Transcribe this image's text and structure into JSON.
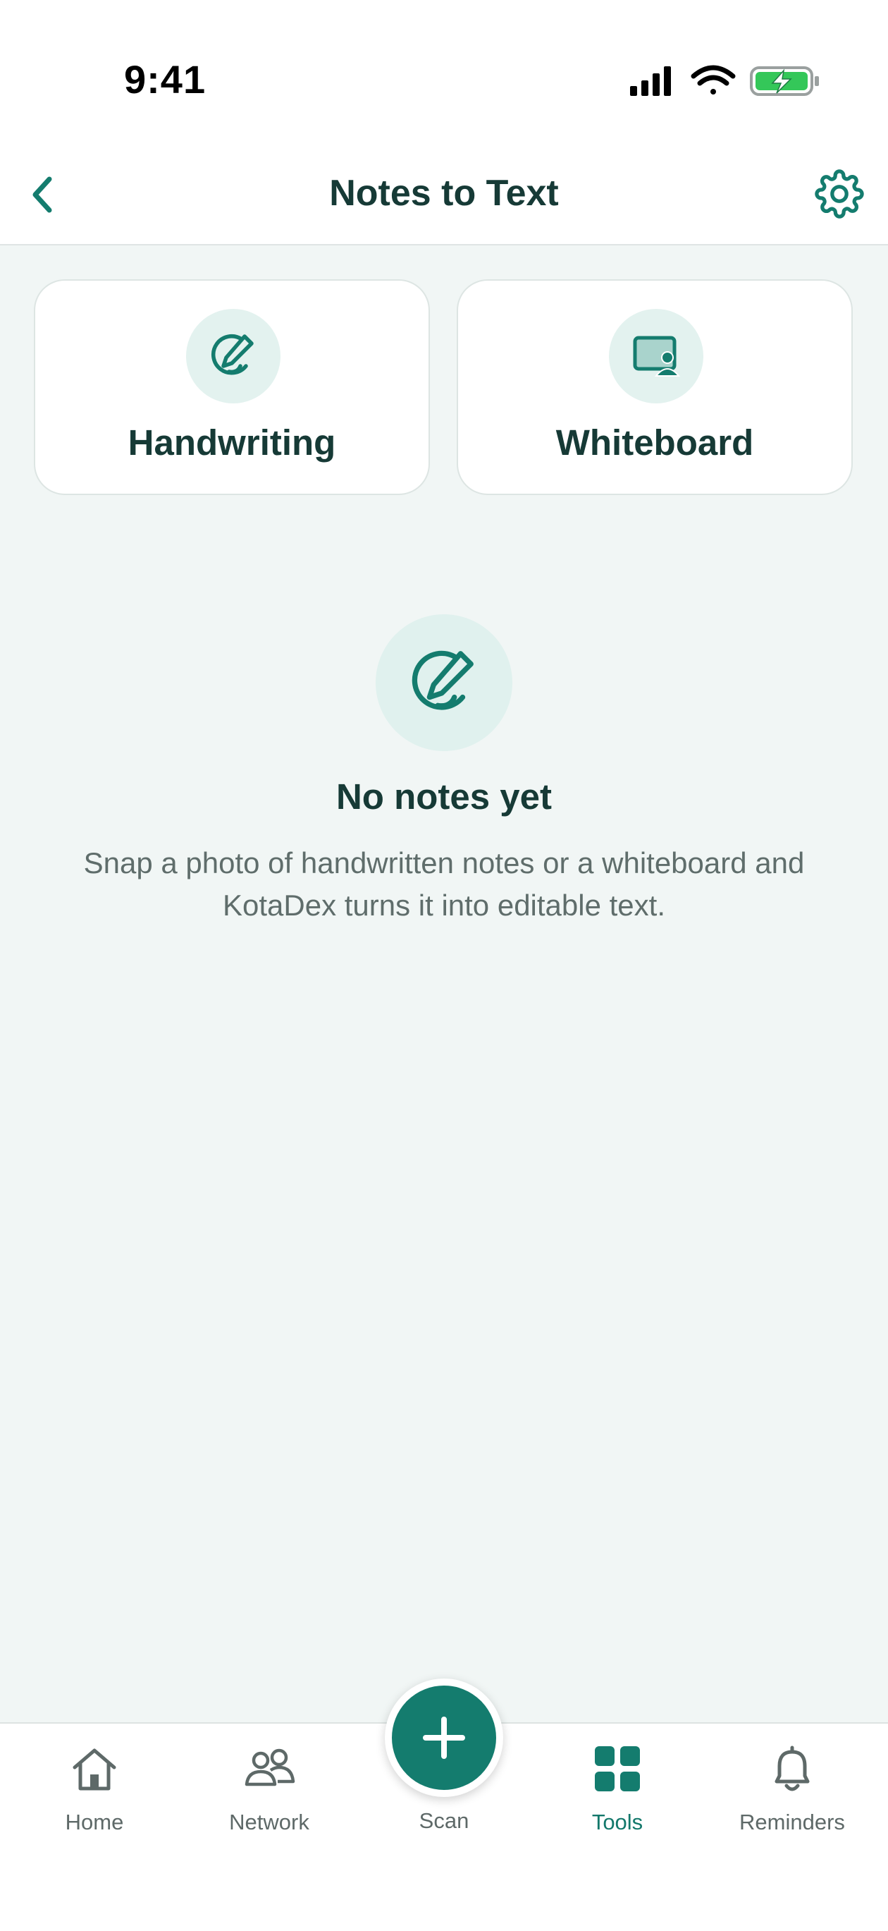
{
  "status_bar": {
    "time": "9:41"
  },
  "header": {
    "title": "Notes to Text",
    "back_icon": "chevron-left-icon",
    "settings_icon": "gear-icon"
  },
  "modes": [
    {
      "label": "Handwriting",
      "icon": "pen-circle-icon"
    },
    {
      "label": "Whiteboard",
      "icon": "whiteboard-presenter-icon"
    }
  ],
  "empty_state": {
    "icon": "pen-circle-icon",
    "title": "No notes yet",
    "description": "Snap a photo of handwritten notes or a whiteboard and KotaDex turns it into editable text."
  },
  "tab_bar": {
    "items": [
      {
        "label": "Home",
        "icon": "home-icon"
      },
      {
        "label": "Network",
        "icon": "people-icon"
      },
      {
        "label": "Scan",
        "icon": "plus-icon"
      },
      {
        "label": "Tools",
        "icon": "grid-icon",
        "active": true
      },
      {
        "label": "Reminders",
        "icon": "bell-icon"
      }
    ]
  },
  "colors": {
    "accent": "#147c6e",
    "background": "#f1f6f5",
    "text_primary": "#163a36",
    "text_secondary": "#5f6d6b",
    "battery_fill": "#34c759"
  }
}
